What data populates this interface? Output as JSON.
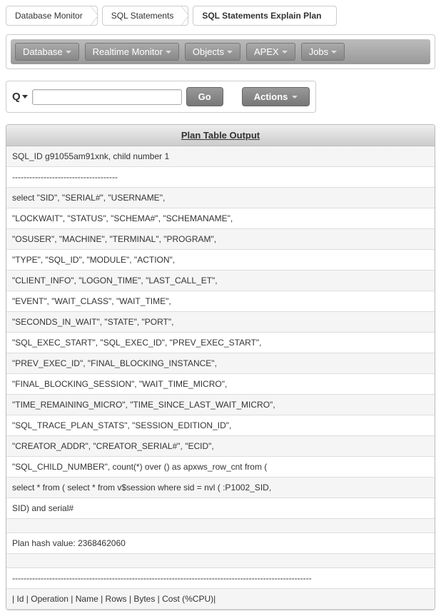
{
  "breadcrumb": {
    "items": [
      {
        "label": "Database Monitor"
      },
      {
        "label": "SQL Statements"
      },
      {
        "label": "SQL Statements Explain Plan"
      }
    ]
  },
  "menubar": {
    "items": [
      {
        "label": "Database"
      },
      {
        "label": "Realtime Monitor"
      },
      {
        "label": "Objects"
      },
      {
        "label": "APEX"
      },
      {
        "label": "Jobs"
      }
    ]
  },
  "search": {
    "go_label": "Go",
    "actions_label": "Actions",
    "value": ""
  },
  "plan": {
    "header": "Plan Table Output",
    "rows": [
      "SQL_ID g91055am91xnk, child number 1",
      "-------------------------------------",
      "select \"SID\", \"SERIAL#\", \"USERNAME\",",
      "\"LOCKWAIT\", \"STATUS\", \"SCHEMA#\", \"SCHEMANAME\",",
      "\"OSUSER\", \"MACHINE\", \"TERMINAL\", \"PROGRAM\",",
      "\"TYPE\", \"SQL_ID\", \"MODULE\", \"ACTION\",",
      "\"CLIENT_INFO\", \"LOGON_TIME\", \"LAST_CALL_ET\",",
      "\"EVENT\", \"WAIT_CLASS\", \"WAIT_TIME\",",
      "\"SECONDS_IN_WAIT\", \"STATE\", \"PORT\",",
      "\"SQL_EXEC_START\", \"SQL_EXEC_ID\", \"PREV_EXEC_START\",",
      "\"PREV_EXEC_ID\", \"FINAL_BLOCKING_INSTANCE\",",
      "\"FINAL_BLOCKING_SESSION\", \"WAIT_TIME_MICRO\",",
      "\"TIME_REMAINING_MICRO\", \"TIME_SINCE_LAST_WAIT_MICRO\",",
      "\"SQL_TRACE_PLAN_STATS\", \"SESSION_EDITION_ID\",",
      "\"CREATOR_ADDR\", \"CREATOR_SERIAL#\", \"ECID\",",
      "\"SQL_CHILD_NUMBER\", count(*) over () as apxws_row_cnt from (",
      "select * from ( select * from v$session where sid = nvl ( :P1002_SID,",
      "SID) and serial#",
      "",
      "Plan hash value: 2368462060",
      "",
      "---------------------------------------------------------------------------------------------------------",
      "| Id | Operation | Name | Rows | Bytes | Cost (%CPU)|"
    ]
  }
}
